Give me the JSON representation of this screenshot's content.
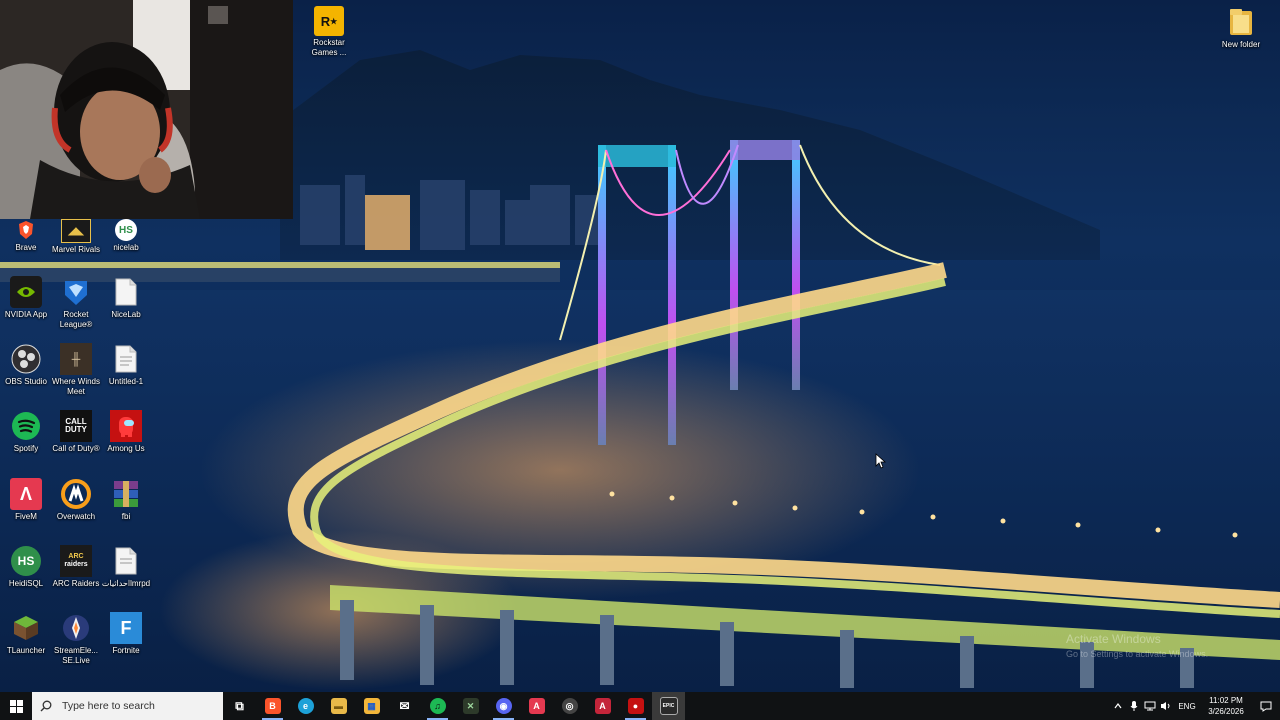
{
  "desktop": {
    "top_icons": [
      {
        "label": "Rockstar Games ...",
        "icon": "rockstar-icon",
        "color": "#f4b400"
      },
      {
        "label": "New folder",
        "icon": "folder-icon",
        "color": "#f2c94c"
      }
    ],
    "icons": [
      {
        "label": "Brave",
        "icon": "brave-icon",
        "color": "#fb542b"
      },
      {
        "label": "Marvel Rivals",
        "icon": "marvel-rivals-icon",
        "color": "#e8c04a"
      },
      {
        "label": "nicelab",
        "icon": "heidisql-icon",
        "color": "#2f8f4a"
      },
      {
        "label": "NVIDIA App",
        "icon": "nvidia-icon",
        "color": "#76b900"
      },
      {
        "label": "Rocket League®",
        "icon": "rocket-league-icon",
        "color": "#1f6fd1"
      },
      {
        "label": "NiceLab",
        "icon": "file-icon",
        "color": "#eeeeee"
      },
      {
        "label": "OBS Studio",
        "icon": "obs-icon",
        "color": "#302e31"
      },
      {
        "label": "Where Winds Meet",
        "icon": "where-winds-meet-icon",
        "color": "#3b3026"
      },
      {
        "label": "Untitled-1",
        "icon": "file-icon",
        "color": "#eeeeee"
      },
      {
        "label": "Spotify",
        "icon": "spotify-icon",
        "color": "#1db954"
      },
      {
        "label": "Call of Duty®",
        "icon": "call-of-duty-icon",
        "color": "#111111"
      },
      {
        "label": "Among Us",
        "icon": "among-us-icon",
        "color": "#c51111"
      },
      {
        "label": "FiveM",
        "icon": "fivem-icon",
        "color": "#e53950"
      },
      {
        "label": "Overwatch",
        "icon": "overwatch-icon",
        "color": "#f99e1a"
      },
      {
        "label": "fbi",
        "icon": "winrar-icon",
        "color": "#7a3d8c"
      },
      {
        "label": "HeidiSQL",
        "icon": "heidisql-icon",
        "color": "#2f8f4a"
      },
      {
        "label": "ARC Raiders",
        "icon": "arc-raiders-icon",
        "color": "#1a1a1a"
      },
      {
        "label": "احداثياتlmrpd",
        "icon": "file-icon",
        "color": "#eeeeee"
      },
      {
        "label": "TLauncher",
        "icon": "minecraft-icon",
        "color": "#5a8f32"
      },
      {
        "label": "StreamEle... SE.Live",
        "icon": "streamelements-icon",
        "color": "#2a3b7a"
      },
      {
        "label": "Fortnite",
        "icon": "fortnite-icon",
        "color": "#2a8bd8"
      }
    ]
  },
  "watermark": {
    "title": "Activate Windows",
    "subtitle": "Go to Settings to activate Windows."
  },
  "taskbar": {
    "search_placeholder": "Type here to search",
    "apps": [
      {
        "name": "task-view-icon",
        "glyph": "⧉",
        "color": "#101214"
      },
      {
        "name": "brave-icon",
        "glyph": "B",
        "color": "#fb542b"
      },
      {
        "name": "edge-icon",
        "glyph": "e",
        "color": "#1da1d8"
      },
      {
        "name": "file-explorer-icon",
        "glyph": "▬",
        "color": "#e9b949"
      },
      {
        "name": "store-icon",
        "glyph": "▦",
        "color": "#f3b63a"
      },
      {
        "name": "mail-icon",
        "glyph": "✉",
        "color": "#2b2b2b"
      },
      {
        "name": "spotify-icon",
        "glyph": "♫",
        "color": "#1db954"
      },
      {
        "name": "xbox-icon",
        "glyph": "✕",
        "color": "#2d3a2a"
      },
      {
        "name": "discord-icon",
        "glyph": "◉",
        "color": "#5865f2"
      },
      {
        "name": "app-a-icon",
        "glyph": "A",
        "color": "#e53950"
      },
      {
        "name": "overwatch-icon",
        "glyph": "◎",
        "color": "#444444"
      },
      {
        "name": "fivem-icon",
        "glyph": "A",
        "color": "#c4253a"
      },
      {
        "name": "among-us-icon",
        "glyph": "●",
        "color": "#c51111"
      },
      {
        "name": "epic-games-icon",
        "glyph": "EPIC",
        "color": "#2a2a2a"
      }
    ],
    "tray": {
      "language": "ENG",
      "time": "11:02 PM",
      "date": "3/26/2026"
    }
  }
}
